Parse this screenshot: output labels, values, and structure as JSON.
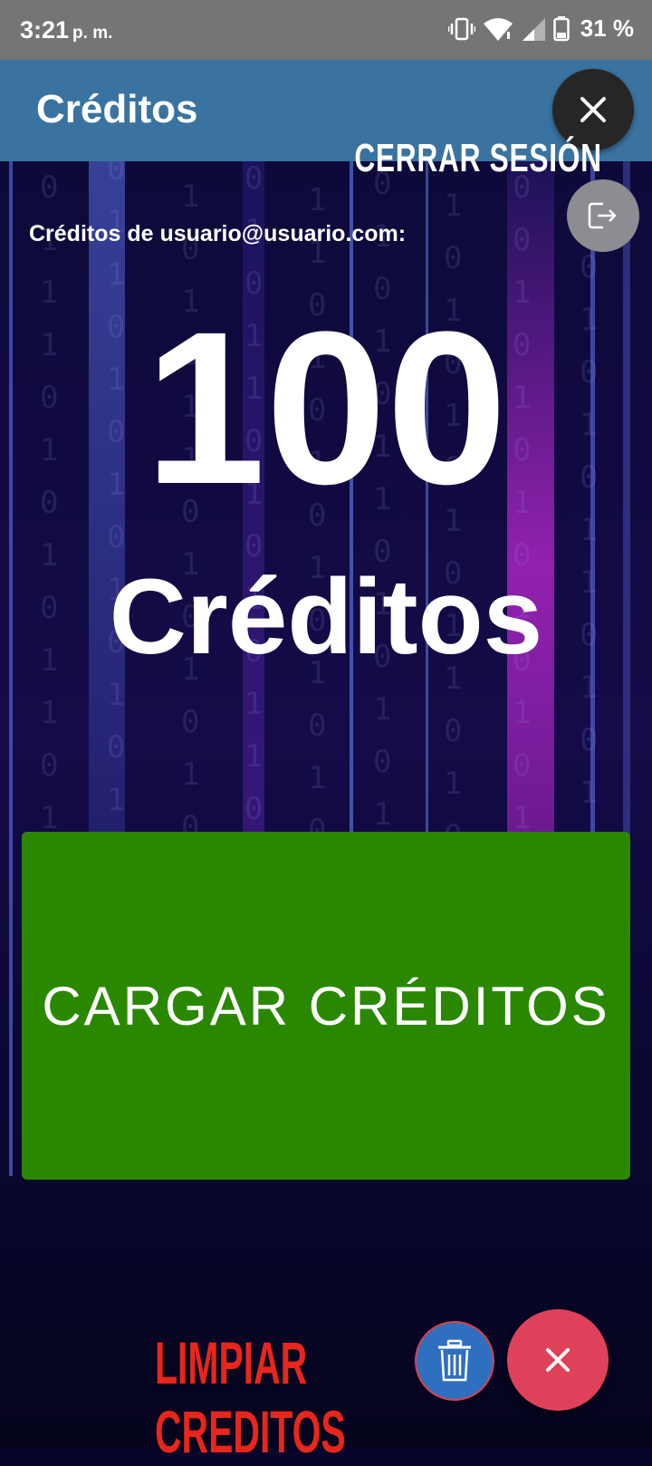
{
  "status_bar": {
    "time": "3:21",
    "ampm": "p. m.",
    "battery": "31 %"
  },
  "app_bar": {
    "title": "Créditos"
  },
  "content": {
    "email_label": "Créditos de usuario@usuario.com:",
    "credit_value": "100",
    "credit_unit": "Créditos",
    "load_button": "CARGAR CRÉDITOS"
  },
  "fab_menu_top": {
    "logout_label": "CERRAR SESIÓN"
  },
  "fab_menu_bottom": {
    "clear_label": "LIMPIAR CREDITOS"
  },
  "colors": {
    "app_bar": "#3a73a0",
    "load_button": "#2a8800",
    "clear_label": "#e8261c",
    "fab_close_bottom": "#e0415a",
    "fab_clear": "#2f6fc0"
  },
  "icons": [
    "vibrate-icon",
    "wifi-icon",
    "signal-icon",
    "battery-icon",
    "close-icon",
    "logout-icon",
    "trash-icon"
  ]
}
